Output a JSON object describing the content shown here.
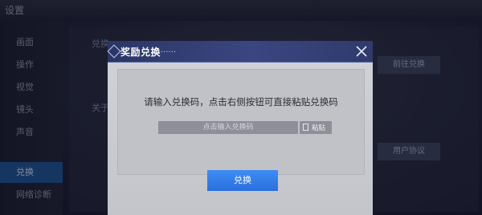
{
  "background": {
    "header_title": "设置",
    "sidebar": [
      {
        "label": "画面",
        "active": false
      },
      {
        "label": "操作",
        "active": false
      },
      {
        "label": "视觉",
        "active": false
      },
      {
        "label": "镜头",
        "active": false
      },
      {
        "label": "声音",
        "active": false
      },
      {
        "label": "兑换",
        "active": true
      },
      {
        "label": "网络诊断",
        "active": false
      }
    ],
    "labels": [
      "兑换",
      "关于"
    ],
    "buttons": [
      "前往兑换",
      "用户协议"
    ]
  },
  "dialog": {
    "title": "奖励兑换",
    "title_dots": "......",
    "instruction": "请输入兑换码，点击右侧按钮可直接粘贴兑换码",
    "code_input": {
      "value": "",
      "placeholder": "点击输入兑换码"
    },
    "paste_label": "粘贴",
    "redeem_label": "兑换"
  },
  "colors": {
    "accent_blue": "#3a8cf0",
    "header_blue": "#344278",
    "dialog_body": "#cbcdd2"
  },
  "icons": {
    "close": "close-icon",
    "paste": "clipboard-icon",
    "title": "diamond-icon"
  }
}
